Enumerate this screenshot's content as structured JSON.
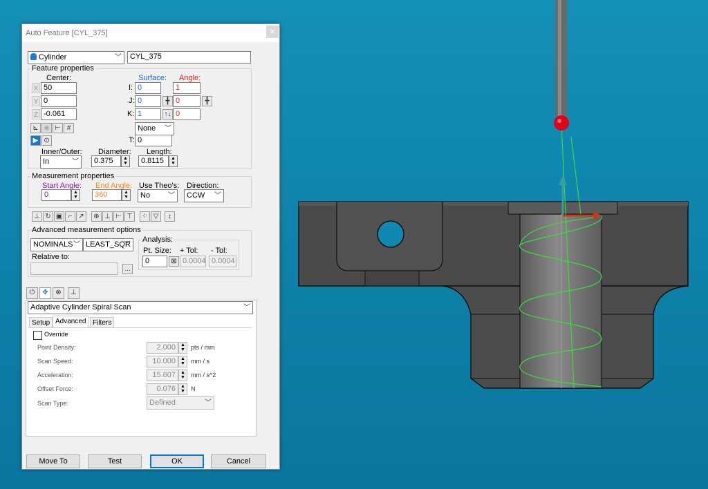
{
  "dialog": {
    "title": "Auto Feature [CYL_375]",
    "close": "×",
    "feature_type": "Cylinder",
    "feature_name": "CYL_375",
    "feature_properties": {
      "label": "Feature properties",
      "center_label": "Center:",
      "surface_label": "Surface:",
      "angle_label": "Angle:",
      "x": {
        "axis": "X",
        "value": "50"
      },
      "y": {
        "axis": "Y",
        "value": "0"
      },
      "z": {
        "axis": "Z",
        "value": "-0.061"
      },
      "i": {
        "axis": "I:",
        "surface": "0",
        "angle": "1"
      },
      "j": {
        "axis": "J:",
        "surface": "0",
        "angle": "0"
      },
      "k": {
        "axis": "K:",
        "surface": "1",
        "angle": "0"
      },
      "none_select": "None",
      "t_label": "T:",
      "t_value": "0",
      "inner_outer_label": "Inner/Outer:",
      "inner_outer_value": "In",
      "diameter_label": "Diameter:",
      "diameter_value": "0.375",
      "length_label": "Length:",
      "length_value": "0.8115"
    },
    "measurement_properties": {
      "label": "Measurement properties",
      "start_angle_label": "Start Angle:",
      "start_angle_value": "0",
      "end_angle_label": "End Angle:",
      "end_angle_value": "360",
      "use_theos_label": "Use Theo's:",
      "use_theos_value": "No",
      "direction_label": "Direction:",
      "direction_value": "CCW"
    },
    "advanced_measurement": {
      "label": "Advanced measurement options",
      "nominals_value": "NOMINALS",
      "fit_value": "LEAST_SQR",
      "relative_to_label": "Relative to:",
      "relative_to_value": "",
      "browse_label": "...",
      "analysis_label": "Analysis:",
      "pt_size_label": "Pt. Size:",
      "pt_size_value": "0",
      "plus_tol_label": "+ Tol:",
      "plus_tol_value": "0.0004",
      "minus_tol_label": "- Tol:",
      "minus_tol_value": "0.0004"
    },
    "strategy": {
      "value": "Adaptive Cylinder Spiral Scan",
      "tabs": [
        "Setup",
        "Advanced",
        "Filters"
      ],
      "active_tab": "Advanced",
      "override_label": "Override",
      "rows": [
        {
          "label": "Point Density:",
          "value": "2.000",
          "unit": "pts / mm"
        },
        {
          "label": "Scan Speed:",
          "value": "10.000",
          "unit": "mm / s"
        },
        {
          "label": "Acceleration:",
          "value": "15.607",
          "unit": "mm / s^2"
        },
        {
          "label": "Offset Force:",
          "value": "0.076",
          "unit": "N"
        }
      ],
      "scan_type_label": "Scan Type:",
      "scan_type_value": "Defined"
    },
    "buttons": {
      "move_to": "Move To",
      "test": "Test",
      "ok": "OK",
      "cancel": "Cancel"
    }
  },
  "colors": {
    "background": "#1590b8",
    "surface_blue": "#1c64c8",
    "angle_red": "#e0201c",
    "end_angle_orange": "#f08a16",
    "start_angle_purple": "#8a1ea0",
    "ok_border": "#0078d7",
    "scan_path_green": "#3cdc3c"
  },
  "viewport": {
    "part": "cylinder-hole-part",
    "probe": "probe-stylus"
  }
}
